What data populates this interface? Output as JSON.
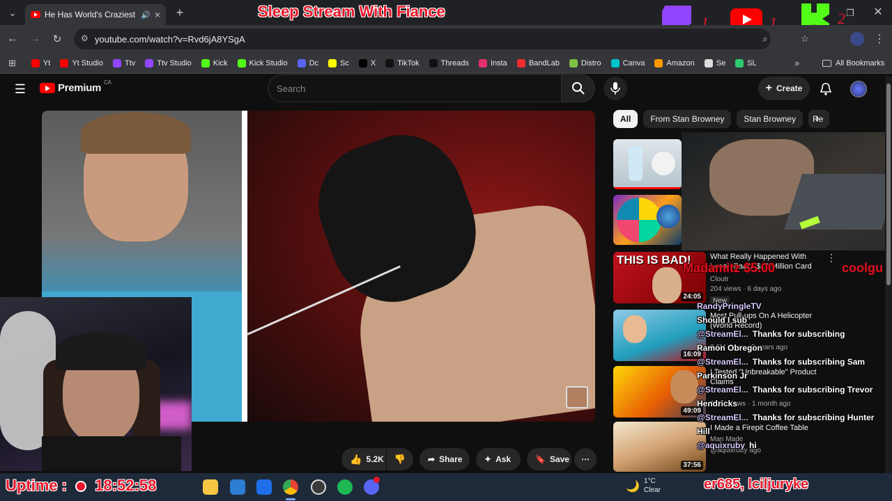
{
  "browser": {
    "tab_title": "He Has World's Craziest Bo",
    "url": "youtube.com/watch?v=Rvd6jA8YSgA",
    "bookmarks": [
      {
        "label": "Yt",
        "color": "#ff0000"
      },
      {
        "label": "Yt Studio",
        "color": "#ff0000"
      },
      {
        "label": "Ttv",
        "color": "#9146ff"
      },
      {
        "label": "Ttv Studio",
        "color": "#9146ff"
      },
      {
        "label": "Kick",
        "color": "#53fc18"
      },
      {
        "label": "Kick Studio",
        "color": "#53fc18"
      },
      {
        "label": "Dc",
        "color": "#5865f2"
      },
      {
        "label": "Sc",
        "color": "#fffc00"
      },
      {
        "label": "X",
        "color": "#000000"
      },
      {
        "label": "TikTok",
        "color": "#111111"
      },
      {
        "label": "Threads",
        "color": "#111111"
      },
      {
        "label": "Insta",
        "color": "#e1306c"
      },
      {
        "label": "BandLab",
        "color": "#f12c2c"
      },
      {
        "label": "Distro",
        "color": "#7cc142"
      },
      {
        "label": "Canva",
        "color": "#00c4cc"
      },
      {
        "label": "Amazon",
        "color": "#ff9900"
      },
      {
        "label": "Se",
        "color": "#dddddd"
      },
      {
        "label": "SL",
        "color": "#2ecc71"
      }
    ],
    "all_bookmarks": "All Bookmarks"
  },
  "stream_overlay": {
    "title": "Sleep Stream With Fiance",
    "twitch_count": "1",
    "youtube_count": "1",
    "kick_count": "2",
    "uptime_label": "Uptime :",
    "uptime_value": "18:52:58",
    "ticker": "er685, lciljuryke",
    "donation": "Madamitz $5.00",
    "donation2": "coolgu"
  },
  "youtube": {
    "logo_text": "Premium",
    "country": "CA",
    "search_placeholder": "Search",
    "create_label": "Create",
    "actions": {
      "likes": "5.2K",
      "share": "Share",
      "ask": "Ask",
      "save": "Save"
    },
    "chips": [
      "All",
      "From Stan Browney",
      "Stan Browney",
      "Re"
    ],
    "recommendations": [
      {
        "title": "What Really Happened With Logan Paul's $16 Million Card",
        "channel": "Cloutr",
        "meta": "204 views · 6 days ago",
        "badge": "New",
        "duration": "24:05",
        "thumb_text": "THIS IS BAD!"
      },
      {
        "title": "Most Pull-ups On A Helicopter (World Record)",
        "channel": "@StreamEl...",
        "meta": "2.8M views · 3 years ago",
        "duration": "16:09"
      },
      {
        "title": "I Tested \"Unbreakable\" Product Claims",
        "channel": "@StreamEl...",
        "meta": "731K views · 1 month ago",
        "duration": "49:09"
      },
      {
        "title": "I Made a Firepit Coffee Table",
        "channel": "Man Made",
        "meta": "@aquixruby ago",
        "duration": "37:56"
      }
    ]
  },
  "chat": [
    {
      "user": "RandyPringleTV",
      "msg": ""
    },
    {
      "user": "",
      "msg": "Should I sub"
    },
    {
      "user": "@StreamEl...",
      "msg": "Thanks for subscribing"
    },
    {
      "user": "",
      "msg": "Ramon Obregon"
    },
    {
      "user": "@StreamEl...",
      "msg": "Thanks for subscribing Sam"
    },
    {
      "user": "",
      "msg": "Parkinson Jr"
    },
    {
      "user": "@StreamEl...",
      "msg": "Thanks for subscribing Trevor"
    },
    {
      "user": "",
      "msg": "Hendricks"
    },
    {
      "user": "@StreamEl...",
      "msg": "Thanks for subscribing Hunter"
    },
    {
      "user": "",
      "msg": "Hill"
    },
    {
      "user": "@aquixruby",
      "msg": "hi"
    }
  ],
  "taskbar": {
    "temperature": "1°C",
    "condition": "Clear"
  }
}
